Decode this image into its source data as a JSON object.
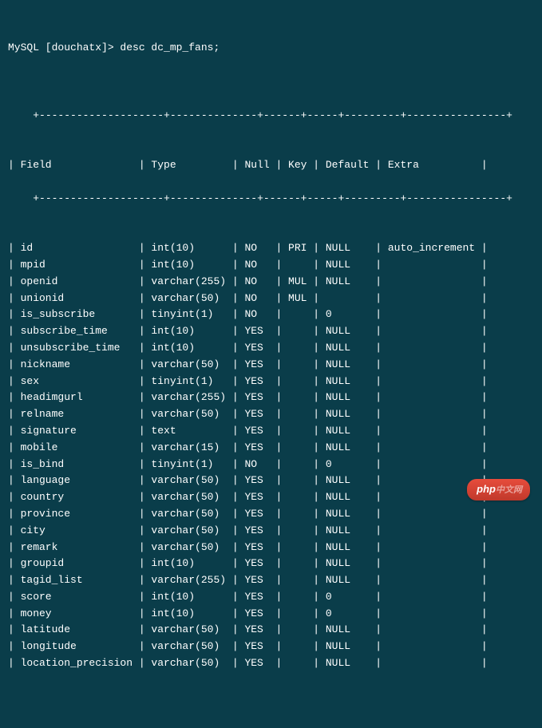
{
  "prompt": "MySQL [douchatx]> desc dc_mp_fans;",
  "headers": {
    "field": "Field",
    "type": "Type",
    "null": "Null",
    "key": "Key",
    "default": "Default",
    "extra": "Extra"
  },
  "rows": [
    {
      "field": "id",
      "type": "int(10)",
      "null": "NO",
      "key": "PRI",
      "default": "NULL",
      "extra": "auto_increment"
    },
    {
      "field": "mpid",
      "type": "int(10)",
      "null": "NO",
      "key": "",
      "default": "NULL",
      "extra": ""
    },
    {
      "field": "openid",
      "type": "varchar(255)",
      "null": "NO",
      "key": "MUL",
      "default": "NULL",
      "extra": ""
    },
    {
      "field": "unionid",
      "type": "varchar(50)",
      "null": "NO",
      "key": "MUL",
      "default": "",
      "extra": ""
    },
    {
      "field": "is_subscribe",
      "type": "tinyint(1)",
      "null": "NO",
      "key": "",
      "default": "0",
      "extra": ""
    },
    {
      "field": "subscribe_time",
      "type": "int(10)",
      "null": "YES",
      "key": "",
      "default": "NULL",
      "extra": ""
    },
    {
      "field": "unsubscribe_time",
      "type": "int(10)",
      "null": "YES",
      "key": "",
      "default": "NULL",
      "extra": ""
    },
    {
      "field": "nickname",
      "type": "varchar(50)",
      "null": "YES",
      "key": "",
      "default": "NULL",
      "extra": ""
    },
    {
      "field": "sex",
      "type": "tinyint(1)",
      "null": "YES",
      "key": "",
      "default": "NULL",
      "extra": ""
    },
    {
      "field": "headimgurl",
      "type": "varchar(255)",
      "null": "YES",
      "key": "",
      "default": "NULL",
      "extra": ""
    },
    {
      "field": "relname",
      "type": "varchar(50)",
      "null": "YES",
      "key": "",
      "default": "NULL",
      "extra": ""
    },
    {
      "field": "signature",
      "type": "text",
      "null": "YES",
      "key": "",
      "default": "NULL",
      "extra": ""
    },
    {
      "field": "mobile",
      "type": "varchar(15)",
      "null": "YES",
      "key": "",
      "default": "NULL",
      "extra": ""
    },
    {
      "field": "is_bind",
      "type": "tinyint(1)",
      "null": "NO",
      "key": "",
      "default": "0",
      "extra": ""
    },
    {
      "field": "language",
      "type": "varchar(50)",
      "null": "YES",
      "key": "",
      "default": "NULL",
      "extra": ""
    },
    {
      "field": "country",
      "type": "varchar(50)",
      "null": "YES",
      "key": "",
      "default": "NULL",
      "extra": ""
    },
    {
      "field": "province",
      "type": "varchar(50)",
      "null": "YES",
      "key": "",
      "default": "NULL",
      "extra": ""
    },
    {
      "field": "city",
      "type": "varchar(50)",
      "null": "YES",
      "key": "",
      "default": "NULL",
      "extra": ""
    },
    {
      "field": "remark",
      "type": "varchar(50)",
      "null": "YES",
      "key": "",
      "default": "NULL",
      "extra": ""
    },
    {
      "field": "groupid",
      "type": "int(10)",
      "null": "YES",
      "key": "",
      "default": "NULL",
      "extra": ""
    },
    {
      "field": "tagid_list",
      "type": "varchar(255)",
      "null": "YES",
      "key": "",
      "default": "NULL",
      "extra": ""
    },
    {
      "field": "score",
      "type": "int(10)",
      "null": "YES",
      "key": "",
      "default": "0",
      "extra": ""
    },
    {
      "field": "money",
      "type": "int(10)",
      "null": "YES",
      "key": "",
      "default": "0",
      "extra": ""
    },
    {
      "field": "latitude",
      "type": "varchar(50)",
      "null": "YES",
      "key": "",
      "default": "NULL",
      "extra": ""
    },
    {
      "field": "longitude",
      "type": "varchar(50)",
      "null": "YES",
      "key": "",
      "default": "NULL",
      "extra": ""
    },
    {
      "field": "location_precision",
      "type": "varchar(50)",
      "null": "YES",
      "key": "",
      "default": "NULL",
      "extra": ""
    }
  ],
  "logo": {
    "main": "php",
    "suffix": "中文网"
  },
  "widths": {
    "field": 19,
    "type": 13,
    "null": 5,
    "key": 4,
    "default": 8,
    "extra": 15
  }
}
